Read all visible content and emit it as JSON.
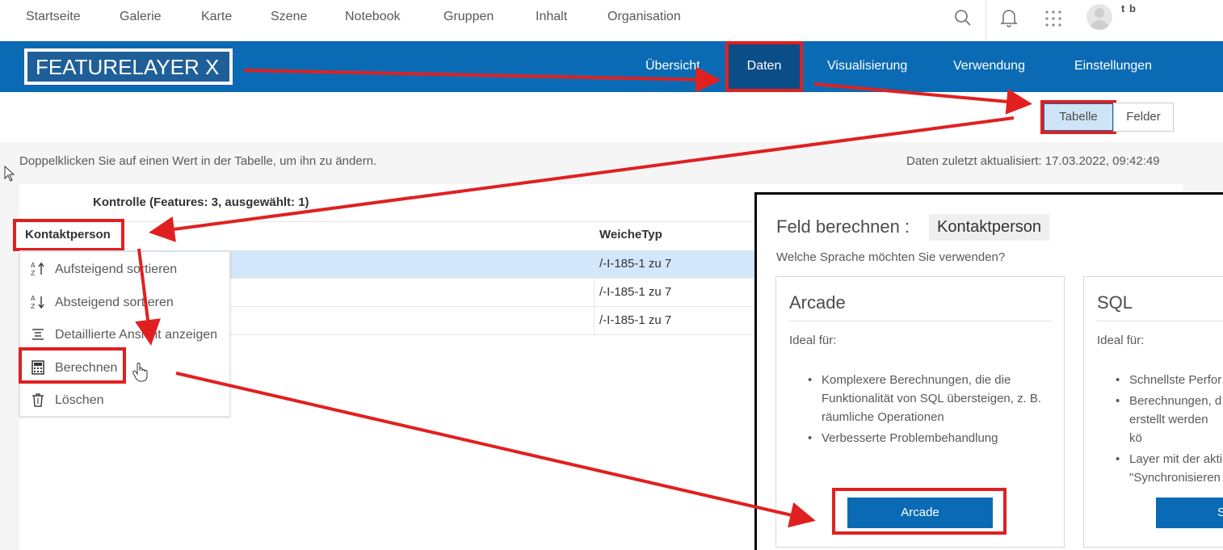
{
  "topnav": {
    "links": [
      "Startseite",
      "Galerie",
      "Karte",
      "Szene",
      "Notebook",
      "Gruppen",
      "Inhalt",
      "Organisation"
    ],
    "user_initials": "t b",
    "icons": [
      "search-icon",
      "bell-icon",
      "apps-grid-icon",
      "avatar"
    ]
  },
  "banner": {
    "item_title": "FEATURELAYER X",
    "tabs": [
      "Übersicht",
      "Daten",
      "Visualisierung",
      "Verwendung",
      "Einstellungen"
    ],
    "active_tab": "Daten"
  },
  "view_toggle": {
    "table": "Tabelle",
    "fields": "Felder",
    "selected": "Tabelle"
  },
  "data_view": {
    "hint": "Doppelklicken Sie auf einen Wert in der Tabelle, um ihn zu ändern.",
    "last_updated": "Daten zuletzt aktualisiert: 17.03.2022, 09:42:49",
    "table_title": "Kontrolle (Features: 3, ausgewählt: 1)",
    "columns": [
      "Kontaktperson",
      "WeicheTyp"
    ],
    "rows": [
      {
        "kontaktperson": "",
        "weichetyp": "/-I-185-1 zu 7",
        "selected": true
      },
      {
        "kontaktperson": "",
        "weichetyp": "/-I-185-1 zu 7",
        "selected": false
      },
      {
        "kontaktperson": "",
        "weichetyp": "/-I-185-1 zu 7",
        "selected": false
      }
    ]
  },
  "context_menu": {
    "items": [
      {
        "label": "Aufsteigend sortieren",
        "icon": "sort-ascending-icon"
      },
      {
        "label": "Absteigend sortieren",
        "icon": "sort-descending-icon"
      },
      {
        "label": "Detaillierte Ansicht anzeigen",
        "icon": "detail-view-icon"
      },
      {
        "label": "Berechnen",
        "icon": "calculator-icon"
      },
      {
        "label": "Löschen",
        "icon": "trash-icon"
      }
    ]
  },
  "calculate_dialog": {
    "title": "Feld berechnen :",
    "field": "Kontaktperson",
    "question": "Welche Sprache möchten Sie verwenden?",
    "arcade": {
      "title": "Arcade",
      "ideal_for": "Ideal für:",
      "bullets": [
        "Komplexere Berechnungen, die die\nFunktionalität von SQL übersteigen, z. B.\nräumliche Operationen",
        "Verbesserte Problembehandlung"
      ],
      "button": "Arcade"
    },
    "sql": {
      "title": "SQL",
      "ideal_for": "Ideal für:",
      "bullets": [
        "Schnellste Perfor",
        "Berechnungen, d\nerstellt werden kö",
        "Layer mit der akti\n\"Synchronisieren\naktualisierte Feat"
      ],
      "button": "S"
    }
  },
  "colors": {
    "brand_blue": "#0a6bb4",
    "active_tab": "#0b4d86",
    "annotation_red": "#e02020",
    "selected_row": "#d2e7f9"
  }
}
